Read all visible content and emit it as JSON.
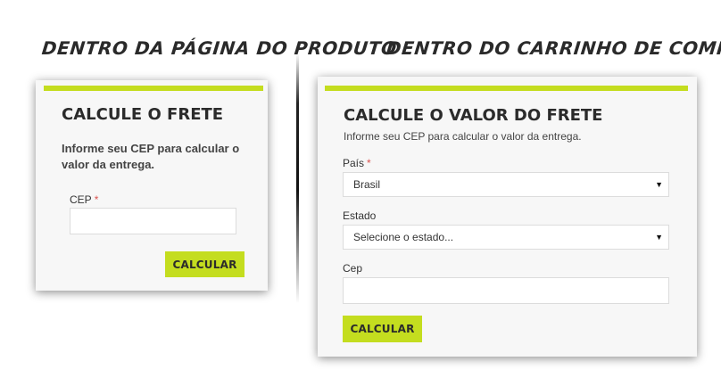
{
  "headings": {
    "left": "DENTRO DA PÁGINA DO PRODUTO",
    "right": "DENTRO DO CARRINHO DE COMPRAS"
  },
  "product_card": {
    "title": "CALCULE O FRETE",
    "description": "Informe seu CEP para calcular o valor da entrega.",
    "cep_label": "CEP",
    "required_mark": "*",
    "cep_value": "",
    "button_label": "CALCULAR"
  },
  "cart_card": {
    "title": "CALCULE O VALOR DO FRETE",
    "description": "Informe seu CEP para calcular o valor da entrega.",
    "country_label": "País",
    "required_mark": "*",
    "country_value": "Brasil",
    "state_label": "Estado",
    "state_value": "Selecione o estado...",
    "cep_label": "Cep",
    "cep_value": "",
    "button_label": "CALCULAR"
  },
  "colors": {
    "accent": "#c4dd1f",
    "card_background": "#f7f7f7",
    "required": "#d9534f"
  },
  "icons": {
    "dropdown": "chevron-down-icon"
  }
}
